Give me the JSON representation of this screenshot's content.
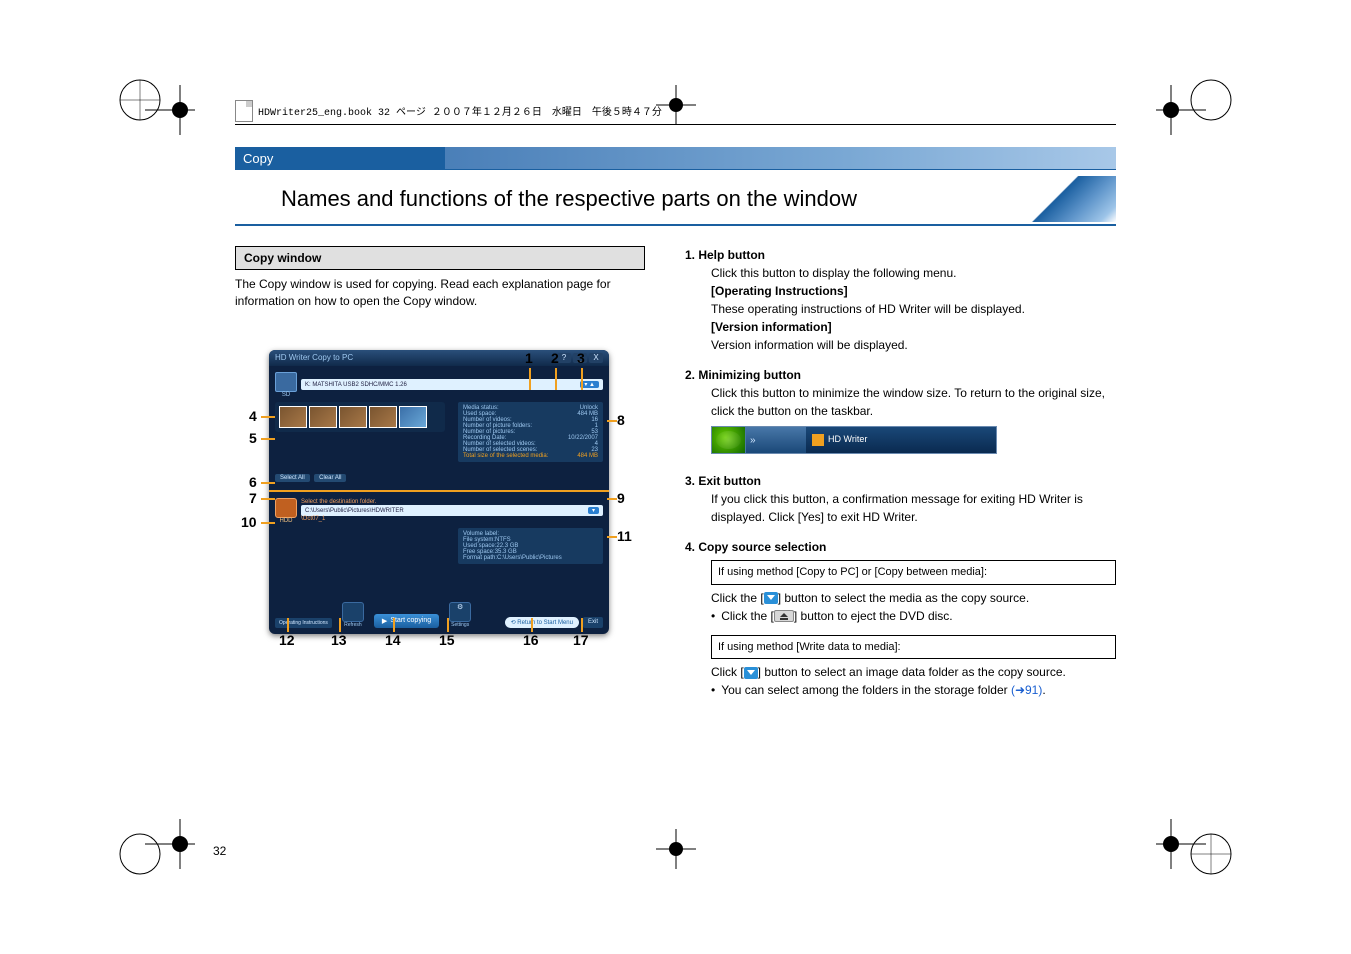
{
  "header_line": "HDWriter25_eng.book  32 ページ  ２００７年１２月２６日　水曜日　午後５時４７分",
  "section_tab": "Copy",
  "page_title": "Names and functions of the respective parts on the window",
  "left": {
    "box_title": "Copy window",
    "intro": "The Copy window is used for copying. Read each explanation page for information on how to open the Copy window.",
    "callouts_top": [
      "1",
      "2",
      "3"
    ],
    "callouts_left": [
      "4",
      "5",
      "6",
      "7",
      "10"
    ],
    "callouts_right": [
      "8",
      "9",
      "11"
    ],
    "callouts_bottom": [
      "12",
      "13",
      "14",
      "15",
      "16",
      "17"
    ],
    "app": {
      "title": "HD Writer   Copy to PC",
      "help_btn": "?",
      "min_btn": "_",
      "close_btn": "X",
      "src_media": "K: MATSHITA USB2  SDHC/MMC 1.26",
      "src_label": "SD",
      "stats": {
        "media_status_l": "Media status:",
        "media_status_v": "Unlock",
        "used_space_l": "Used space:",
        "used_space_v": "484 MB",
        "nvideos_l": "Number of videos:",
        "nvideos_v": "16",
        "nfolders_l": "Number of picture folders:",
        "nfolders_v": "1",
        "npictures_l": "Number of pictures:",
        "npictures_v": "53",
        "recdate_l": "Recording Date:",
        "recdate_v": "10/22/2007",
        "nselvid_l": "Number of selected videos:",
        "nselvid_v": "4",
        "nselscn_l": "Number of selected scenes:",
        "nselscn_v": "23",
        "totsize_l": "Total size of the selected media:",
        "totsize_v": "484 MB"
      },
      "select_all": "Select All",
      "clear_all": "Clear All",
      "dest_hint": "Select the destination folder.",
      "dest_label": "HDD",
      "dest_path": "C:\\Users\\Public\\Pictures\\HDWRITER",
      "dest_date": "\\Oct07_1",
      "dest_stats": {
        "vol_l": "Volume label:",
        "vol_v": "",
        "fs_l": "File system:",
        "fs_v": "NTFS",
        "used_l": "Used space:",
        "used_v": "22.3 GB",
        "free_l": "Free space:",
        "free_v": "35.3 GB",
        "fpath_l": "Format path:",
        "fpath_v": "C:\\Users\\Public\\Pictures"
      },
      "refresh_label": "Refresh",
      "start": "Start copying",
      "settings_label": "Settings",
      "return": "Return to Start Menu",
      "exit": "Exit",
      "oi": "Operating Instructions"
    }
  },
  "right": {
    "i1_t": "1. Help button",
    "i1_l1": "Click this button to display the following menu.",
    "i1_b1": "[Operating Instructions]",
    "i1_l2": "These operating instructions of HD Writer will be displayed.",
    "i1_b2": "[Version information]",
    "i1_l3": "Version information will be displayed.",
    "i2_t": "2. Minimizing button",
    "i2_l1": "Click this button to minimize the window size. To return to the original size, click the button on the taskbar.",
    "i2_task": "HD Writer",
    "i3_t": "3. Exit button",
    "i3_l1": "If you click this button, a confirmation message for exiting HD Writer is displayed. Click [Yes] to exit HD Writer.",
    "i4_t": "4. Copy source selection",
    "i4_box1": "If using method [Copy to PC] or [Copy between media]:",
    "i4_a1a": "Click the [",
    "i4_a1b": "] button to select the media as the copy source.",
    "i4_b1a": "Click the [",
    "i4_b1b": "] button to eject the DVD disc.",
    "i4_box2": "If using method [Write data to media]:",
    "i4_a2a": "Click [",
    "i4_a2b": "] button to select an image data folder as the copy source.",
    "i4_b2": "You can select among the folders in the storage folder ",
    "i4_link": "(➜91)",
    "i4_dot": "."
  },
  "page_number": "32"
}
